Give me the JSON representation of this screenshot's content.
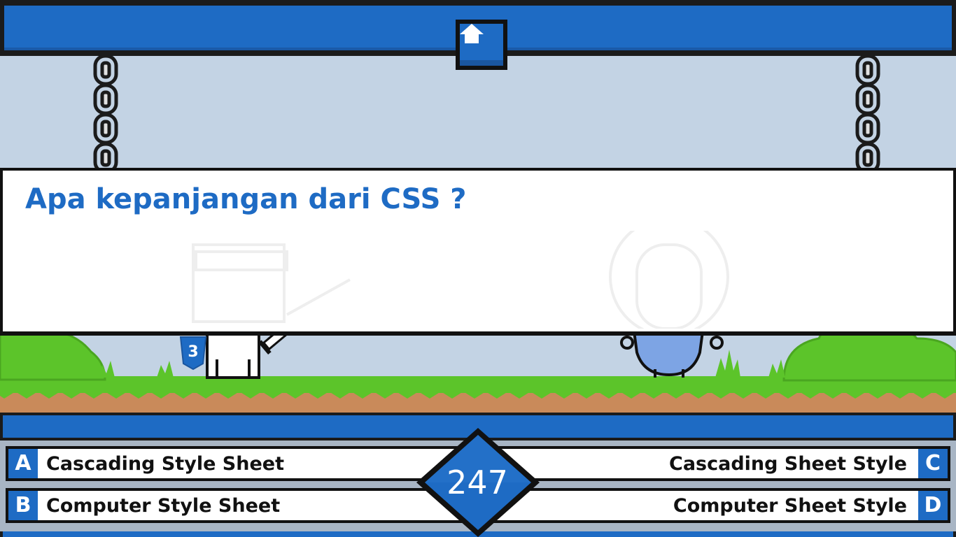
{
  "header": {
    "home_icon": "home-icon"
  },
  "question": {
    "text": "Apa kepanjangan dari CSS ?"
  },
  "answers": [
    {
      "letter": "A",
      "text": "Cascading Style Sheet"
    },
    {
      "letter": "B",
      "text": "Computer Style Sheet"
    },
    {
      "letter": "C",
      "text": "Cascading Sheet Style"
    },
    {
      "letter": "D",
      "text": "Computer Sheet Style"
    }
  ],
  "score": {
    "value": "247"
  },
  "colors": {
    "primary_blue": "#1e6bc4",
    "sky": "#c3d3e4",
    "grass": "#5cc42a",
    "dirt": "#c98a5a",
    "panel_border": "#111111"
  },
  "characters": {
    "player": "css-knight",
    "enemy": "blue-blob-astronaut"
  }
}
